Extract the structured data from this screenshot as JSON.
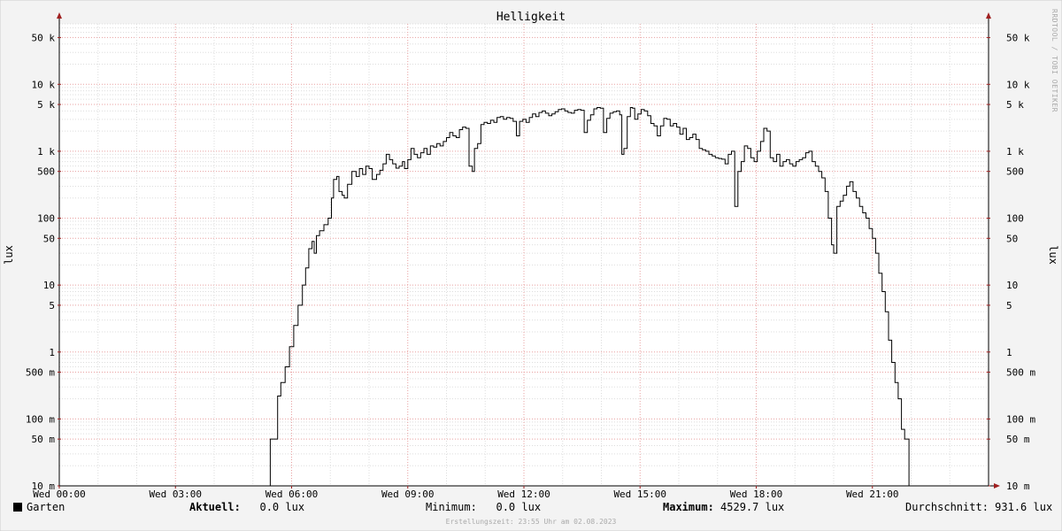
{
  "chart_data": {
    "type": "line",
    "title": "Helligkeit",
    "ylabel": "lux",
    "ylabel_right": "lux",
    "yscale": "log",
    "ylim": [
      0.01,
      80000
    ],
    "xlim": [
      0,
      86400
    ],
    "x_unit": "seconds of day (Wed)",
    "grid": true,
    "y_ticks": [
      {
        "value": 0.01,
        "label": "10 m"
      },
      {
        "value": 0.05,
        "label": "50 m"
      },
      {
        "value": 0.1,
        "label": "100 m"
      },
      {
        "value": 0.5,
        "label": "500 m"
      },
      {
        "value": 1,
        "label": "1"
      },
      {
        "value": 5,
        "label": "5"
      },
      {
        "value": 10,
        "label": "10"
      },
      {
        "value": 50,
        "label": "50"
      },
      {
        "value": 100,
        "label": "100"
      },
      {
        "value": 500,
        "label": "500"
      },
      {
        "value": 1000,
        "label": "1 k"
      },
      {
        "value": 5000,
        "label": "5 k"
      },
      {
        "value": 10000,
        "label": "10 k"
      },
      {
        "value": 50000,
        "label": "50 k"
      }
    ],
    "x_ticks": [
      {
        "value": 0,
        "label": "Wed 00:00"
      },
      {
        "value": 10800,
        "label": "Wed 03:00"
      },
      {
        "value": 21600,
        "label": "Wed 06:00"
      },
      {
        "value": 32400,
        "label": "Wed 09:00"
      },
      {
        "value": 43200,
        "label": "Wed 12:00"
      },
      {
        "value": 54000,
        "label": "Wed 15:00"
      },
      {
        "value": 64800,
        "label": "Wed 18:00"
      },
      {
        "value": 75600,
        "label": "Wed 21:00"
      }
    ],
    "series": [
      {
        "name": "Garten",
        "color": "#000000",
        "points": [
          [
            0,
            0.01
          ],
          [
            19620,
            0.01
          ],
          [
            19620,
            0.05
          ],
          [
            20300,
            0.05
          ],
          [
            20300,
            0.22
          ],
          [
            20600,
            0.35
          ],
          [
            21000,
            0.6
          ],
          [
            21400,
            1.2
          ],
          [
            21800,
            2.5
          ],
          [
            22200,
            5
          ],
          [
            22600,
            10
          ],
          [
            22900,
            18
          ],
          [
            23200,
            35
          ],
          [
            23500,
            45
          ],
          [
            23700,
            30
          ],
          [
            23900,
            55
          ],
          [
            24200,
            65
          ],
          [
            24600,
            80
          ],
          [
            25000,
            100
          ],
          [
            25300,
            200
          ],
          [
            25500,
            380
          ],
          [
            25800,
            420
          ],
          [
            26000,
            250
          ],
          [
            26300,
            220
          ],
          [
            26500,
            200
          ],
          [
            26800,
            320
          ],
          [
            27200,
            500
          ],
          [
            27600,
            420
          ],
          [
            27900,
            550
          ],
          [
            28200,
            450
          ],
          [
            28500,
            600
          ],
          [
            28800,
            550
          ],
          [
            29100,
            380
          ],
          [
            29500,
            450
          ],
          [
            29800,
            520
          ],
          [
            30100,
            650
          ],
          [
            30400,
            900
          ],
          [
            30700,
            750
          ],
          [
            31000,
            650
          ],
          [
            31300,
            560
          ],
          [
            31600,
            600
          ],
          [
            31900,
            700
          ],
          [
            32100,
            550
          ],
          [
            32400,
            750
          ],
          [
            32700,
            1100
          ],
          [
            33000,
            900
          ],
          [
            33300,
            800
          ],
          [
            33600,
            950
          ],
          [
            33900,
            1100
          ],
          [
            34200,
            900
          ],
          [
            34500,
            1200
          ],
          [
            34800,
            1150
          ],
          [
            35100,
            1300
          ],
          [
            35400,
            1200
          ],
          [
            35700,
            1400
          ],
          [
            36000,
            1600
          ],
          [
            36300,
            1900
          ],
          [
            36600,
            1700
          ],
          [
            36900,
            1600
          ],
          [
            37200,
            2100
          ],
          [
            37500,
            2300
          ],
          [
            37800,
            2200
          ],
          [
            38100,
            600
          ],
          [
            38400,
            500
          ],
          [
            38600,
            1100
          ],
          [
            38900,
            1300
          ],
          [
            39200,
            2500
          ],
          [
            39500,
            2700
          ],
          [
            39800,
            2600
          ],
          [
            40100,
            2900
          ],
          [
            40400,
            2700
          ],
          [
            40700,
            3200
          ],
          [
            41000,
            3300
          ],
          [
            41300,
            3000
          ],
          [
            41600,
            3200
          ],
          [
            41900,
            3100
          ],
          [
            42200,
            2800
          ],
          [
            42500,
            1700
          ],
          [
            42800,
            2800
          ],
          [
            43100,
            3000
          ],
          [
            43400,
            2700
          ],
          [
            43700,
            3200
          ],
          [
            44000,
            3600
          ],
          [
            44300,
            3300
          ],
          [
            44600,
            3800
          ],
          [
            44900,
            4000
          ],
          [
            45200,
            3700
          ],
          [
            45500,
            3400
          ],
          [
            45800,
            3600
          ],
          [
            46100,
            3900
          ],
          [
            46400,
            4200
          ],
          [
            46700,
            4300
          ],
          [
            47000,
            4000
          ],
          [
            47300,
            3800
          ],
          [
            47600,
            3700
          ],
          [
            47900,
            4100
          ],
          [
            48200,
            4200
          ],
          [
            48500,
            4100
          ],
          [
            48800,
            1900
          ],
          [
            49100,
            2900
          ],
          [
            49400,
            3500
          ],
          [
            49700,
            4300
          ],
          [
            50000,
            4500
          ],
          [
            50300,
            4400
          ],
          [
            50600,
            1900
          ],
          [
            50900,
            3100
          ],
          [
            51200,
            3700
          ],
          [
            51500,
            3900
          ],
          [
            51800,
            4000
          ],
          [
            52100,
            3500
          ],
          [
            52300,
            900
          ],
          [
            52500,
            1100
          ],
          [
            52800,
            3300
          ],
          [
            53100,
            4500
          ],
          [
            53300,
            4400
          ],
          [
            53500,
            3000
          ],
          [
            53800,
            3600
          ],
          [
            54100,
            4200
          ],
          [
            54400,
            4000
          ],
          [
            54700,
            3400
          ],
          [
            55000,
            2600
          ],
          [
            55300,
            2400
          ],
          [
            55600,
            1700
          ],
          [
            55900,
            2400
          ],
          [
            56200,
            3100
          ],
          [
            56500,
            3000
          ],
          [
            56800,
            2400
          ],
          [
            57100,
            2600
          ],
          [
            57400,
            2300
          ],
          [
            57700,
            1800
          ],
          [
            58000,
            2200
          ],
          [
            58300,
            1500
          ],
          [
            58600,
            1600
          ],
          [
            58900,
            1800
          ],
          [
            59200,
            1500
          ],
          [
            59500,
            1100
          ],
          [
            59800,
            1050
          ],
          [
            60100,
            1000
          ],
          [
            60400,
            900
          ],
          [
            60700,
            850
          ],
          [
            61000,
            800
          ],
          [
            61300,
            780
          ],
          [
            61600,
            760
          ],
          [
            61900,
            650
          ],
          [
            62200,
            900
          ],
          [
            62500,
            1000
          ],
          [
            62800,
            150
          ],
          [
            63100,
            500
          ],
          [
            63400,
            700
          ],
          [
            63700,
            1200
          ],
          [
            64000,
            1100
          ],
          [
            64300,
            800
          ],
          [
            64600,
            700
          ],
          [
            64900,
            1000
          ],
          [
            65200,
            1400
          ],
          [
            65500,
            2200
          ],
          [
            65800,
            2000
          ],
          [
            66100,
            800
          ],
          [
            66400,
            700
          ],
          [
            66700,
            900
          ],
          [
            67000,
            600
          ],
          [
            67300,
            700
          ],
          [
            67600,
            750
          ],
          [
            67900,
            650
          ],
          [
            68200,
            600
          ],
          [
            68500,
            700
          ],
          [
            68800,
            750
          ],
          [
            69100,
            800
          ],
          [
            69400,
            950
          ],
          [
            69700,
            1000
          ],
          [
            70000,
            700
          ],
          [
            70300,
            600
          ],
          [
            70600,
            500
          ],
          [
            70900,
            400
          ],
          [
            71200,
            250
          ],
          [
            71500,
            100
          ],
          [
            71800,
            40
          ],
          [
            72000,
            30
          ],
          [
            72300,
            150
          ],
          [
            72600,
            180
          ],
          [
            72900,
            220
          ],
          [
            73200,
            300
          ],
          [
            73500,
            350
          ],
          [
            73800,
            250
          ],
          [
            74100,
            200
          ],
          [
            74400,
            150
          ],
          [
            74700,
            120
          ],
          [
            75000,
            100
          ],
          [
            75300,
            70
          ],
          [
            75600,
            50
          ],
          [
            75900,
            30
          ],
          [
            76200,
            15
          ],
          [
            76500,
            8
          ],
          [
            76800,
            4
          ],
          [
            77100,
            1.5
          ],
          [
            77400,
            0.7
          ],
          [
            77700,
            0.35
          ],
          [
            78000,
            0.2
          ],
          [
            78300,
            0.07
          ],
          [
            78600,
            0.05
          ],
          [
            78900,
            0.05
          ],
          [
            79000,
            0.01
          ],
          [
            86400,
            0.01
          ]
        ]
      }
    ],
    "legend_position": "bottom-left"
  },
  "legend": {
    "series_label": "Garten",
    "aktuell_label": "Aktuell:",
    "aktuell_value": "0.0 lux",
    "minimum_label": "Minimum:",
    "minimum_value": "0.0 lux",
    "maximum_label": "Maximum:",
    "maximum_value": "4529.7 lux",
    "durchschnitt_label": "Durchschnitt:",
    "durchschnitt_value": "931.6 lux"
  },
  "footer": "Erstellungszeit: 23:55 Uhr am 02.08.2023",
  "watermark": "RRDTOOL / TOBI OETIKER",
  "colors": {
    "background": "#f3f3f3",
    "plot_bg": "#ffffff",
    "grid_minor": "#dddddd",
    "grid_major": "#e8a0a0",
    "line": "#000000",
    "axis_arrow": "#a02020"
  }
}
